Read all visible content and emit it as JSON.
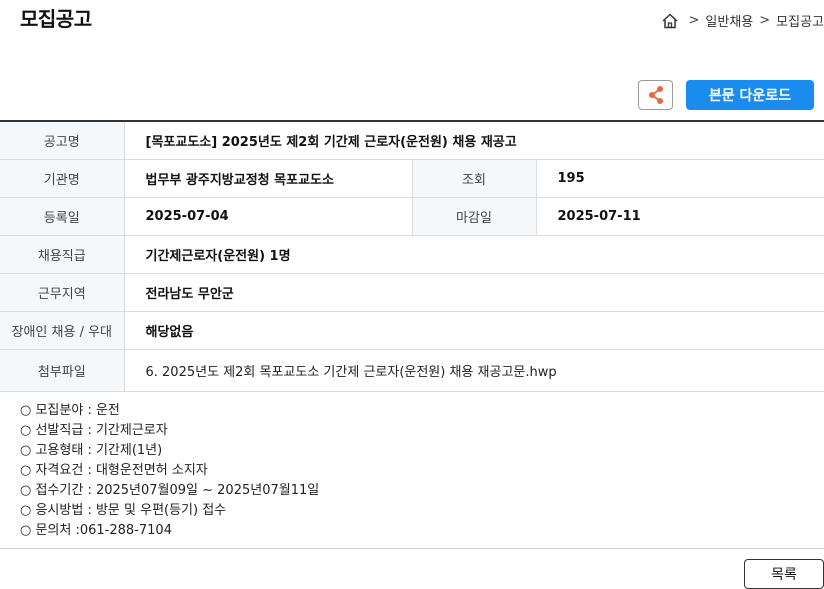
{
  "page": {
    "title": "모집공고"
  },
  "breadcrumb": {
    "sep1": ">",
    "item1": "일반채용",
    "sep2": ">",
    "item2": "모집공고"
  },
  "actions": {
    "download_label": "본문 다운로드"
  },
  "info": {
    "title_label": "공고명",
    "title_value": "[목포교도소] 2025년도 제2회 기간제 근로자(운전원) 채용 재공고",
    "org_label": "기관명",
    "org_value": "법무부 광주지방교정청 목포교도소",
    "views_label": "조회",
    "views_value": "195",
    "reg_label": "등록일",
    "reg_value": "2025-07-04",
    "deadline_label": "마감일",
    "deadline_value": "2025-07-11",
    "position_label": "채용직급",
    "position_value": "기간제근로자(운전원) 1명",
    "region_label": "근무지역",
    "region_value": "전라남도 무안군",
    "disability_label": "장애인 채용 / 우대",
    "disability_value": "해당없음",
    "attach_label": "첨부파일",
    "attach_value": "6. 2025년도 제2회 목포교도소 기간제 근로자(운전원) 채용 재공고문.hwp"
  },
  "description": [
    "○ 모집분야 : 운전",
    "○ 선발직급 : 기간제근로자",
    "○ 고용형태 : 기간제(1년)",
    "○ 자격요건 : 대형운전면허 소지자",
    "○ 접수기간 : 2025년07월09일 ~ 2025년07월11일",
    "○ 응시방법 : 방문 및 우편(등기) 접수",
    "○ 문의처 :061-288-7104"
  ],
  "footer": {
    "list_label": "목록"
  },
  "colors": {
    "accent": "#1a8cf0",
    "share_icon": "#e8683f"
  }
}
